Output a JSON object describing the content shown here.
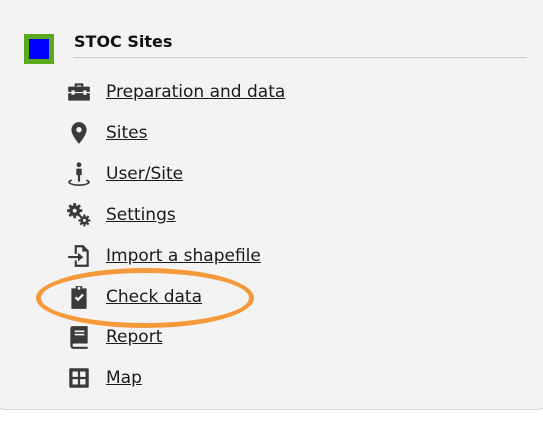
{
  "section": {
    "title": "STOC Sites",
    "swatch_colors": {
      "border": "#5ba91e",
      "fill": "#0000ff"
    }
  },
  "menu": {
    "items": [
      {
        "label": "Preparation and data",
        "icon": "toolbox-icon"
      },
      {
        "label": "Sites",
        "icon": "map-marker-icon"
      },
      {
        "label": "User/Site",
        "icon": "person-pin-icon"
      },
      {
        "label": "Settings",
        "icon": "gears-icon"
      },
      {
        "label": "Import a shapefile",
        "icon": "file-import-icon"
      },
      {
        "label": "Check data",
        "icon": "clipboard-check-icon"
      },
      {
        "label": "Report",
        "icon": "book-icon"
      },
      {
        "label": "Map",
        "icon": "grid-map-icon"
      }
    ]
  },
  "annotation": {
    "highlighted_item": "Check data",
    "highlight_color": "#f59a3a"
  }
}
